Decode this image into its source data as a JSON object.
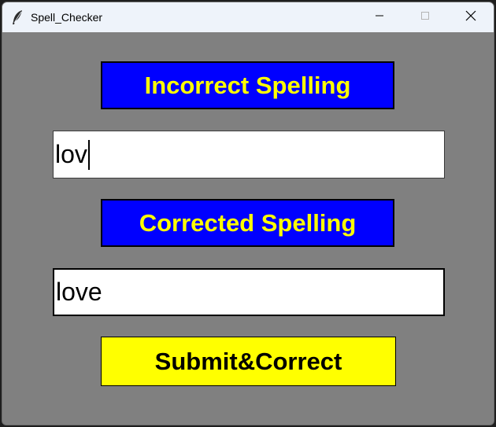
{
  "window": {
    "title": "Spell_Checker",
    "icon": "feather-icon",
    "controls": [
      "minimize-icon",
      "maximize-icon",
      "close-icon"
    ]
  },
  "incorrect_label": "Incorrect Spelling",
  "incorrect_input": {
    "value": "lov"
  },
  "corrected_label": "Corrected Spelling",
  "corrected_output": {
    "value": "love"
  },
  "submit_button": "Submit&Correct",
  "colors": {
    "background": "#808080",
    "label_bg": "#0000ff",
    "label_text": "#ffff00",
    "button_bg": "#ffff00",
    "button_text": "#000000",
    "entry_bg": "#ffffff"
  }
}
